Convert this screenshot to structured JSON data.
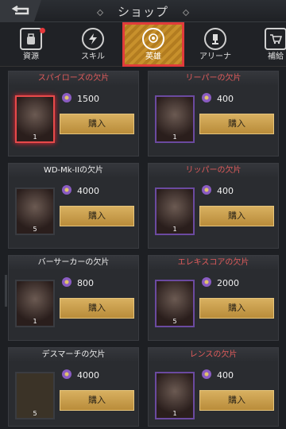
{
  "header": {
    "title": "ショップ"
  },
  "tabs": [
    {
      "label": "資源",
      "icon": "bag-icon",
      "active": false,
      "badge": true
    },
    {
      "label": "スキル",
      "icon": "lightning-icon",
      "active": false,
      "badge": false
    },
    {
      "label": "英雄",
      "icon": "medal-icon",
      "active": true,
      "badge": false
    },
    {
      "label": "アリーナ",
      "icon": "trophy-icon",
      "active": false,
      "badge": false
    },
    {
      "label": "補給",
      "icon": "cart-icon",
      "active": false,
      "badge": false
    }
  ],
  "buy_label": "購入",
  "items": [
    {
      "title": "スパイローズの欠片",
      "price": "1500",
      "count": "1",
      "selected": true
    },
    {
      "title": "リーパーの欠片",
      "price": "400",
      "count": "1",
      "selected": false
    },
    {
      "title": "WD-Mk-IIの欠片",
      "price": "4000",
      "count": "5",
      "selected": false
    },
    {
      "title": "リッパーの欠片",
      "price": "400",
      "count": "1",
      "selected": false
    },
    {
      "title": "バーサーカーの欠片",
      "price": "800",
      "count": "1",
      "selected": false
    },
    {
      "title": "エレキスコアの欠片",
      "price": "2000",
      "count": "5",
      "selected": false
    },
    {
      "title": "デスマーチの欠片",
      "price": "4000",
      "count": "5",
      "selected": false
    },
    {
      "title": "レンスの欠片",
      "price": "400",
      "count": "1",
      "selected": false
    }
  ],
  "colors": {
    "accent": "#c8912c",
    "highlight": "#e13b3b",
    "currency": "#8a5cc2"
  }
}
